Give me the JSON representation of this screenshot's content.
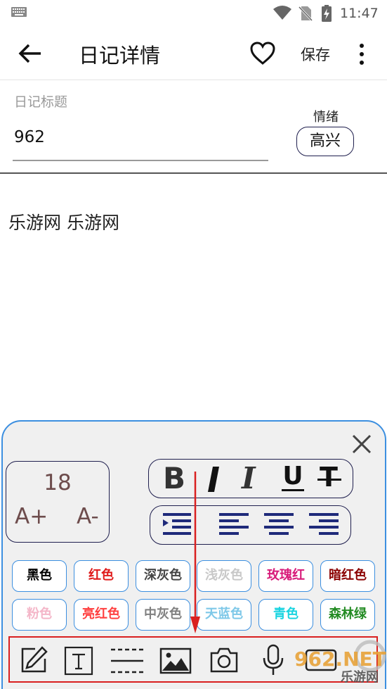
{
  "status": {
    "time": "11:47"
  },
  "appbar": {
    "title": "日记详情",
    "save_label": "保存"
  },
  "form": {
    "title_label": "日记标题",
    "title_value": "962",
    "mood_label": "情绪",
    "mood_value": "高兴"
  },
  "body": {
    "text": "乐游网 乐游网"
  },
  "format": {
    "font_size": "18",
    "increase_label": "A+",
    "decrease_label": "A-",
    "bold": "B",
    "italic": "I",
    "underline": "U",
    "strike": "T"
  },
  "colors": [
    {
      "label": "黑色",
      "color": "#000000"
    },
    {
      "label": "红色",
      "color": "#e01b1b"
    },
    {
      "label": "深灰色",
      "color": "#444444"
    },
    {
      "label": "浅灰色",
      "color": "#c8c8c8"
    },
    {
      "label": "玫瑰红",
      "color": "#d81b7a"
    },
    {
      "label": "暗红色",
      "color": "#8b0000"
    },
    {
      "label": "粉色",
      "color": "#f4b6c8"
    },
    {
      "label": "亮红色",
      "color": "#ff4040"
    },
    {
      "label": "中灰色",
      "color": "#808080"
    },
    {
      "label": "天蓝色",
      "color": "#7ec8e8"
    },
    {
      "label": "青色",
      "color": "#19d4e0"
    },
    {
      "label": "森林绿",
      "color": "#228b22"
    }
  ],
  "accent": "#3c8fe0",
  "highlight": "#d92020",
  "tools": [
    "edit-icon",
    "text-icon",
    "divider-icon",
    "image-icon",
    "camera-icon",
    "mic-icon",
    "video-icon"
  ],
  "watermark": {
    "brand": "962.NET",
    "caption": "乐游网"
  }
}
